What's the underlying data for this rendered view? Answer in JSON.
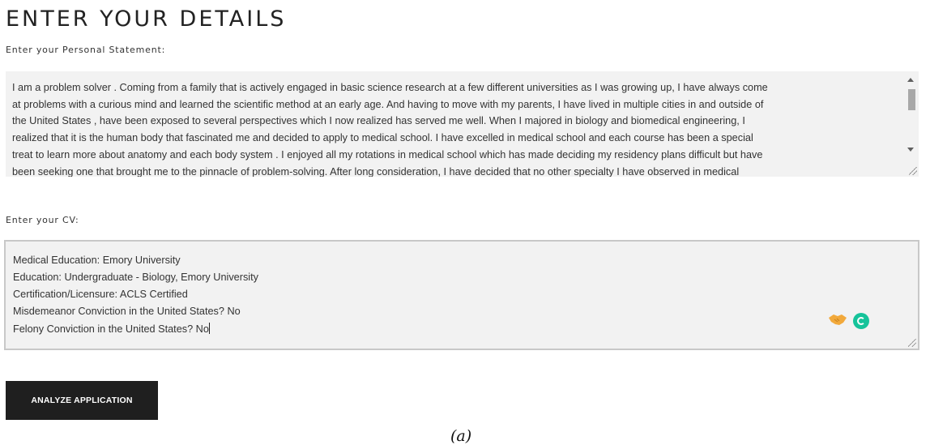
{
  "title": "ENTER YOUR DETAILS",
  "personal_statement": {
    "label": "Enter your Personal Statement:",
    "lines": [
      "I am a problem solver . Coming from a family that is actively engaged in basic science research at a few different universities as I was growing up, I have always come",
      "at problems with a curious mind and learned the scientific method at an early age. And having to move with my parents, I have lived in multiple cities in and outside of",
      "the United States , have been exposed to several perspectives which I now realized has served me well. When I majored in biology and biomedical engineering, I",
      "realized that it is the human body that fascinated me and decided to apply to medical school. I have excelled in medical school and each course has been a special",
      "treat to learn more about anatomy and each body system . I enjoyed all my rotations in medical school which has made deciding my residency plans difficult but have",
      "been seeking one that brought me to the pinnacle of problem-solving. After long consideration, I have decided that no other specialty I have observed in medical"
    ]
  },
  "cv": {
    "label": "Enter your CV:",
    "lines": [
      "Medical Education: Emory University",
      "Education: Undergraduate - Biology, Emory University",
      "Certification/Licensure: ACLS Certified",
      "Misdemeanor Conviction in the United States? No",
      "Felony Conviction in the United States? No"
    ]
  },
  "analyze_button": "ANALYZE APPLICATION",
  "caption": "(a)",
  "colors": {
    "button_bg": "#1f1f1f",
    "field_bg": "#f2f2f2",
    "grammarly": "#15c39a",
    "handshake": "#f2a93b"
  }
}
